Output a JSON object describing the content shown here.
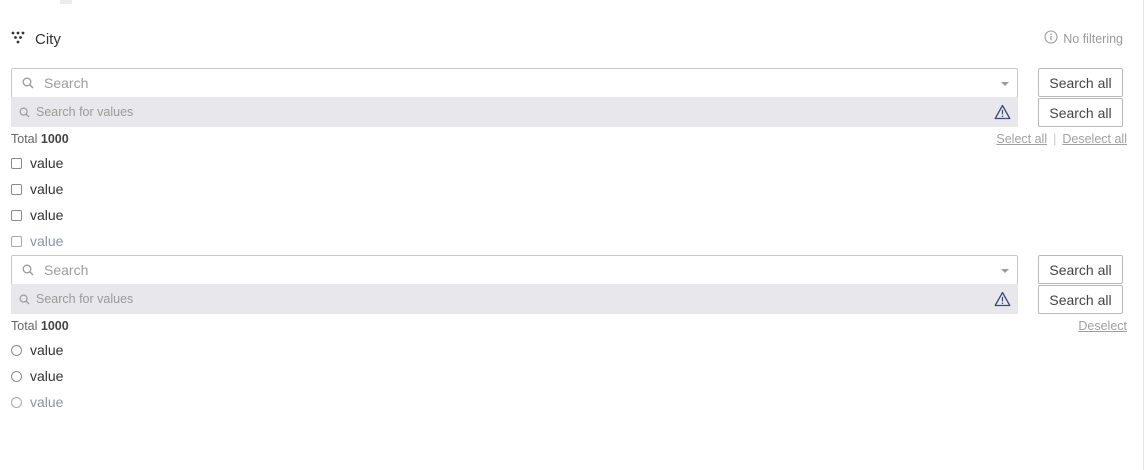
{
  "header": {
    "title": "City",
    "filter_status": "No filtering"
  },
  "multi_select": {
    "search_placeholder": "Search",
    "values_placeholder": "Search for values",
    "search_all_label_1": "Search all",
    "search_all_label_2": "Search all",
    "total_label": "Total",
    "total_count": "1000",
    "select_all_label": "Select all",
    "deselect_all_label": "Deselect all",
    "options": [
      {
        "label": "value",
        "checked": false
      },
      {
        "label": "value",
        "checked": false
      },
      {
        "label": "value",
        "checked": false
      },
      {
        "label": "value",
        "checked": false
      }
    ]
  },
  "single_select": {
    "search_placeholder": "Search",
    "values_placeholder": "Search for values",
    "search_all_label_1": "Search all",
    "search_all_label_2": "Search all",
    "total_label": "Total",
    "total_count": "1000",
    "deselect_label": "Deselect",
    "options": [
      {
        "label": "value",
        "selected": false
      },
      {
        "label": "value",
        "selected": false
      },
      {
        "label": "value",
        "selected": false
      }
    ]
  },
  "colors": {
    "warning_icon": "#3d4a7a",
    "dim_label": "#8a93ab",
    "input_bg": "#e8e8ec"
  }
}
